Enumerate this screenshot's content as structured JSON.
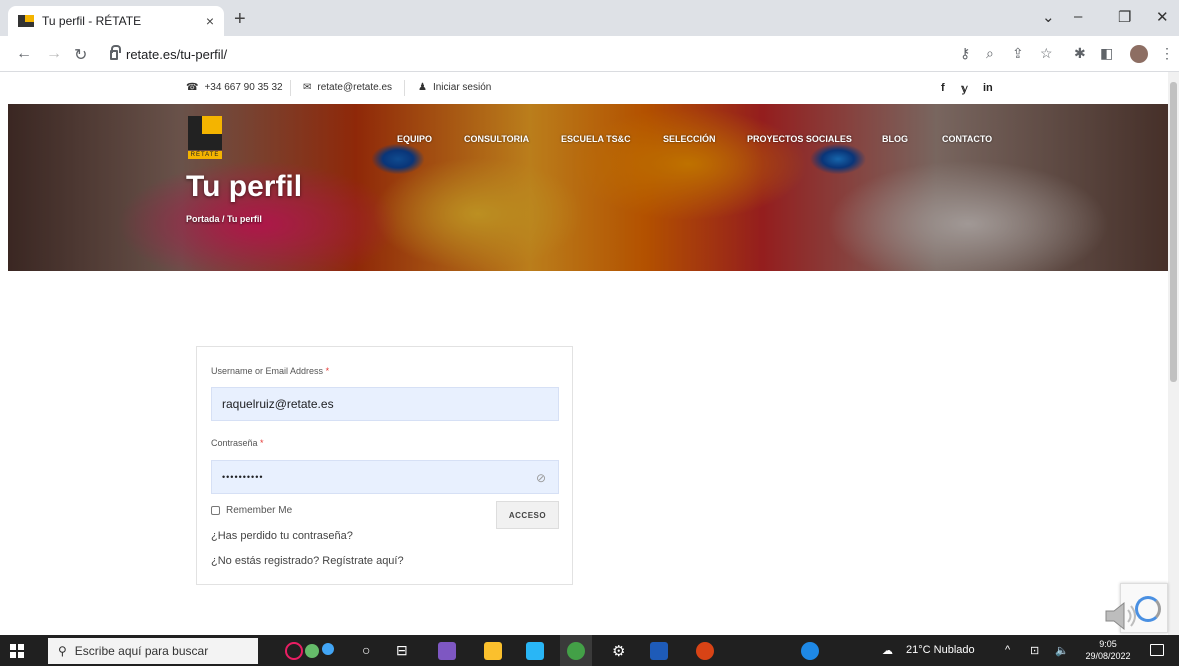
{
  "browser": {
    "tab_title": "Tu perfil - RÉTATE",
    "tab_close": "×",
    "new_tab": "+",
    "url": "retate.es/tu-perfil/",
    "win_minimize": "–",
    "win_restore": "❐",
    "win_close": "✕",
    "win_chevron": "⌄"
  },
  "topbar": {
    "phone": "+34 667 90 35 32",
    "email": "retate@retate.es",
    "login": "Iniciar sesión",
    "social": [
      "f",
      "𝕪",
      "in"
    ]
  },
  "hero": {
    "logo_text": "RÉTATE",
    "menu": [
      "EQUIPO",
      "CONSULTORIA",
      "ESCUELA TS&C",
      "SELECCIÓN",
      "PROYECTOS SOCIALES",
      "BLOG",
      "CONTACTO"
    ],
    "title": "Tu perfil",
    "breadcrumb_home": "Portada",
    "breadcrumb_sep": " / ",
    "breadcrumb_current": "Tu perfil"
  },
  "form": {
    "username_label": "Username or Email Address",
    "required_mark": "*",
    "username_value": "raquelruiz@retate.es",
    "password_label": "Contraseña",
    "password_value": "••••••••••",
    "remember_label": "Remember Me",
    "submit_label": "ACCESO",
    "lost_password": "¿Has perdido tu contraseña?",
    "register": "¿No estás registrado? Regístrate aquí?"
  },
  "taskbar": {
    "search_placeholder": "Escribe aquí para buscar",
    "weather": "21°C  Nublado",
    "time": "9:05",
    "date": "29/08/2022"
  },
  "colors": {
    "accent_yellow": "#f4b400",
    "input_bg": "#e8f0fe",
    "taskbar": "#202020"
  }
}
